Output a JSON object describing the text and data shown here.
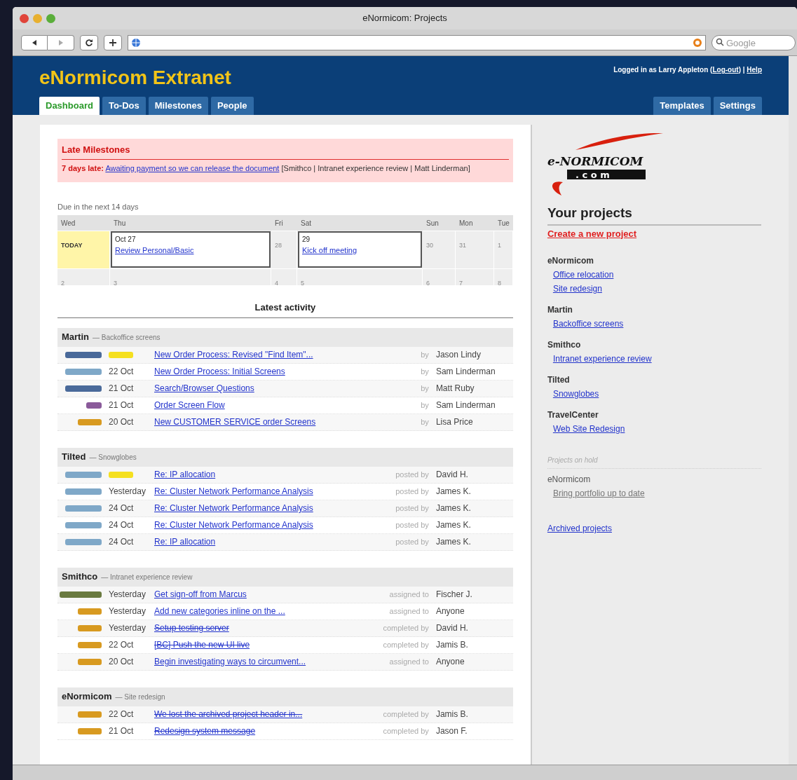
{
  "window": {
    "title": "eNormicom: Projects"
  },
  "toolbar": {
    "search_placeholder": "Google"
  },
  "header": {
    "title": "eNormicom Extranet",
    "user": {
      "prefix": "Logged in as Larry Appleton (",
      "logout": "Log-out",
      "suffix": ") |",
      "help": "Help"
    }
  },
  "tabs": [
    {
      "label": "Dashboard",
      "selected": true
    },
    {
      "label": "To-Dos",
      "selected": false
    },
    {
      "label": "Milestones",
      "selected": false
    },
    {
      "label": "People",
      "selected": false
    }
  ],
  "right_tabs": [
    {
      "label": "Templates",
      "selected": false
    },
    {
      "label": "Settings",
      "selected": false
    }
  ],
  "late_milestones": {
    "title": "Late Milestones",
    "late": "7 days late:",
    "link": "Awaiting payment so we can release the document",
    "details": "[Smithco | Intranet experience review | Matt Linderman]"
  },
  "calendar": {
    "title": "Due in the next 14 days",
    "days": [
      "Wed",
      "Thu",
      "Fri",
      "Sat",
      "Sun",
      "Mon",
      "Tue"
    ],
    "weeks": [
      [
        {
          "label": "TODAY",
          "today": true
        },
        {
          "label": "Oct 27",
          "event": "Review Personal/Basic"
        },
        {
          "label": "28",
          "today": false
        },
        {
          "label": "29",
          "event": "Kick off meeting"
        },
        {
          "label": "30",
          "today": false
        },
        {
          "label": "31",
          "today": false
        },
        {
          "label": "1",
          "today": false
        }
      ],
      [
        {
          "label": "2",
          "today": false
        },
        {
          "label": "3",
          "today": false
        },
        {
          "label": "4",
          "today": false
        },
        {
          "label": "5",
          "today": false
        },
        {
          "label": "6",
          "today": false
        },
        {
          "label": "7",
          "today": false
        },
        {
          "label": "8",
          "today": false
        }
      ]
    ]
  },
  "activity": {
    "title": "Latest activity",
    "groups": [
      {
        "client": "Martin",
        "project": "— Backoffice screens",
        "rows": [
          {
            "kind": "message",
            "color": "#4a6a9a",
            "today": true,
            "title": "New Order Process: Revised \"Find Item\"...",
            "done": false,
            "verb": "by",
            "person": "Jason Lindy"
          },
          {
            "kind": "comment",
            "color": "#7fa8c8",
            "today": false,
            "date": "22 Oct",
            "title": "New Order Process: Initial Screens",
            "done": false,
            "verb": "by",
            "person": "Sam Linderman"
          },
          {
            "kind": "message",
            "color": "#4a6a9a",
            "today": false,
            "date": "21 Oct",
            "title": "Search/Browser Questions",
            "done": false,
            "verb": "by",
            "person": "Matt Ruby"
          },
          {
            "kind": "file",
            "color": "#8a5a9a",
            "today": false,
            "date": "21 Oct",
            "title": "Order Screen Flow",
            "done": false,
            "verb": "by",
            "person": "Sam Linderman"
          },
          {
            "kind": "todo",
            "color": "#d89a20",
            "today": false,
            "date": "20 Oct",
            "title": "New CUSTOMER SERVICE order Screens",
            "done": false,
            "verb": "by",
            "person": "Lisa Price"
          }
        ]
      },
      {
        "client": "Tilted",
        "project": "— Snowglobes",
        "rows": [
          {
            "kind": "comment",
            "color": "#7fa8c8",
            "today": true,
            "title": "Re: IP allocation",
            "done": false,
            "verb": "posted by",
            "person": "David H."
          },
          {
            "kind": "comment",
            "color": "#7fa8c8",
            "today": false,
            "date": "Yesterday",
            "title": "Re: Cluster Network Performance Analysis",
            "done": false,
            "verb": "posted by",
            "person": "James K."
          },
          {
            "kind": "comment",
            "color": "#7fa8c8",
            "today": false,
            "date": "24 Oct",
            "title": "Re: Cluster Network Performance Analysis",
            "done": false,
            "verb": "posted by",
            "person": "James K."
          },
          {
            "kind": "comment",
            "color": "#7fa8c8",
            "today": false,
            "date": "24 Oct",
            "title": "Re: Cluster Network Performance Analysis",
            "done": false,
            "verb": "posted by",
            "person": "James K."
          },
          {
            "kind": "comment",
            "color": "#7fa8c8",
            "today": false,
            "date": "24 Oct",
            "title": "Re: IP allocation",
            "done": false,
            "verb": "posted by",
            "person": "James K."
          }
        ]
      },
      {
        "client": "Smithco",
        "project": "— Intranet experience review",
        "rows": [
          {
            "kind": "milestone",
            "color": "#6a7a40",
            "today": false,
            "date": "Yesterday",
            "title": "Get sign-off from Marcus",
            "done": false,
            "verb": "assigned to",
            "person": "Fischer J."
          },
          {
            "kind": "todo",
            "color": "#d89a20",
            "today": false,
            "date": "Yesterday",
            "title": "Add new categories inline on the ...",
            "done": false,
            "verb": "assigned to",
            "person": "Anyone"
          },
          {
            "kind": "todo",
            "color": "#d89a20",
            "today": false,
            "date": "Yesterday",
            "title": "Setup testing server",
            "done": true,
            "verb": "completed by",
            "person": "David H."
          },
          {
            "kind": "todo",
            "color": "#d89a20",
            "today": false,
            "date": "22 Oct",
            "title": "[BC] Push the new UI live",
            "done": true,
            "verb": "completed by",
            "person": "Jamis B."
          },
          {
            "kind": "todo",
            "color": "#d89a20",
            "today": false,
            "date": "20 Oct",
            "title": "Begin investigating ways to circumvent...",
            "done": false,
            "verb": "assigned to",
            "person": "Anyone"
          }
        ]
      },
      {
        "client": "eNormicom",
        "project": "— Site redesign",
        "rows": [
          {
            "kind": "todo",
            "color": "#d89a20",
            "today": false,
            "date": "22 Oct",
            "title": "We lost the archived project header in...",
            "done": true,
            "verb": "completed by",
            "person": "Jamis B."
          },
          {
            "kind": "todo",
            "color": "#d89a20",
            "today": false,
            "date": "21 Oct",
            "title": "Redesign system message",
            "done": true,
            "verb": "completed by",
            "person": "Jason F."
          }
        ]
      }
    ]
  },
  "sidebar": {
    "logo": {
      "brand": "e-NORMICOM",
      "suffix": ". c o m"
    },
    "title": "Your projects",
    "create": "Create a new project",
    "clients": [
      {
        "name": "eNormicom",
        "projects": [
          "Office relocation",
          "Site redesign"
        ]
      },
      {
        "name": "Martin",
        "projects": [
          "Backoffice screens"
        ]
      },
      {
        "name": "Smithco",
        "projects": [
          "Intranet experience review"
        ]
      },
      {
        "name": "Tilted",
        "projects": [
          "Snowglobes"
        ]
      },
      {
        "name": "TravelCenter",
        "projects": [
          "Web Site Redesign"
        ]
      }
    ],
    "on_hold_title": "Projects on hold",
    "on_hold": [
      {
        "name": "eNormicom",
        "projects": [
          "Bring portfolio up to date"
        ]
      }
    ],
    "archived": "Archived projects"
  }
}
